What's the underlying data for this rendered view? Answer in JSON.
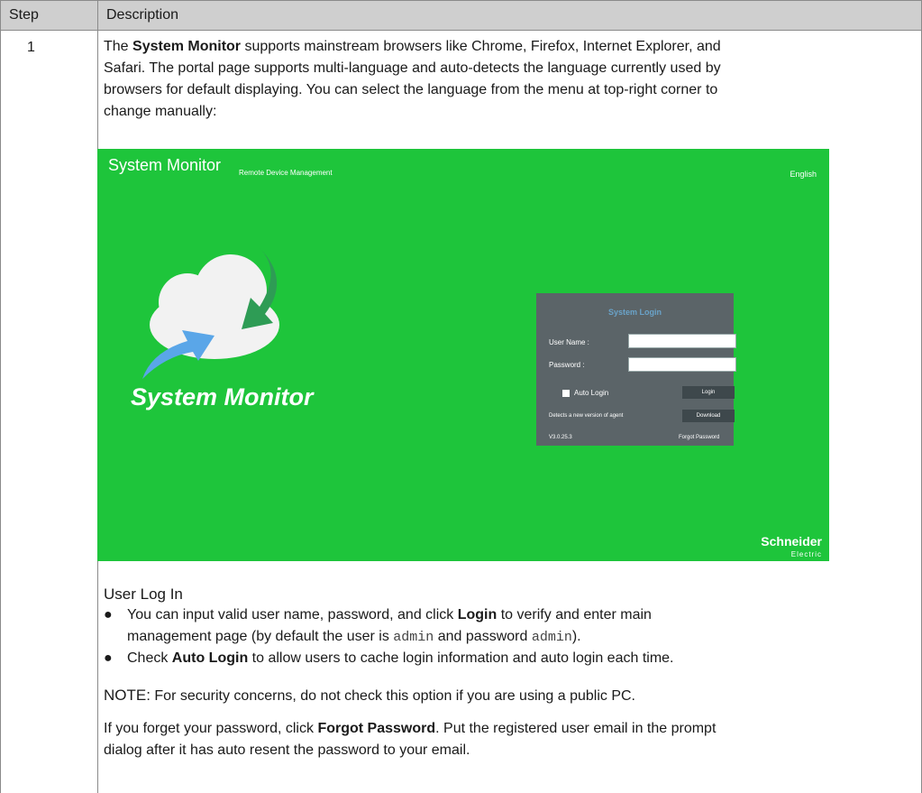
{
  "table": {
    "header_step": "Step",
    "header_description": "Description",
    "step_number": "1"
  },
  "intro": {
    "prefix": "The ",
    "system_monitor": "System Monitor",
    "line1_rest": " supports mainstream browsers like Chrome, Firefox, Internet Explorer, and",
    "line2": "Safari. The portal page supports multi-language and auto-detects the language currently used by",
    "line3": "browsers for default displaying. You can select the language from the menu at top-right corner to",
    "line4": "change manually:"
  },
  "screenshot": {
    "app_title": "System Monitor",
    "app_subtitle": "Remote Device Management",
    "language": "English",
    "logo_text": "System Monitor",
    "login_title": "System Login",
    "user_name_label": "User Name  :",
    "password_label": "Password  :",
    "auto_login_label": "Auto Login",
    "login_button": "Login",
    "agent_notice": "Detects a new version of agent",
    "download_button": "Download",
    "version": "V3.0.25.3",
    "forgot_password": "Forgot Password",
    "brand": "Schneider",
    "brand_sub": "Electric",
    "colors": {
      "background": "#1ec53b",
      "panel": "#5b6468"
    }
  },
  "section": {
    "title": "User Log In",
    "bullet1_line1_pre": "You can input valid user name, password, and click ",
    "bullet1_login": "Login",
    "bullet1_line1_post": " to verify and enter main",
    "bullet1_line2_pre": "management page (by default the user is ",
    "bullet1_admin1": "admin",
    "bullet1_line2_mid": " and password ",
    "bullet1_admin2": "admin",
    "bullet1_line2_post": ").",
    "bullet2_pre": "Check ",
    "bullet2_auto": "Auto Login",
    "bullet2_post": " to allow users to cache login information and auto login each time.",
    "note_label": "NOTE:",
    "note_text": " For security concerns, do not check this option if you are using a public PC.",
    "forgot_line1_pre": "If you forget your password, click ",
    "forgot_bold": "Forgot Password",
    "forgot_line1_post": ". Put the registered user email in the prompt",
    "forgot_line2": "dialog after it has auto resent the password to your email."
  }
}
